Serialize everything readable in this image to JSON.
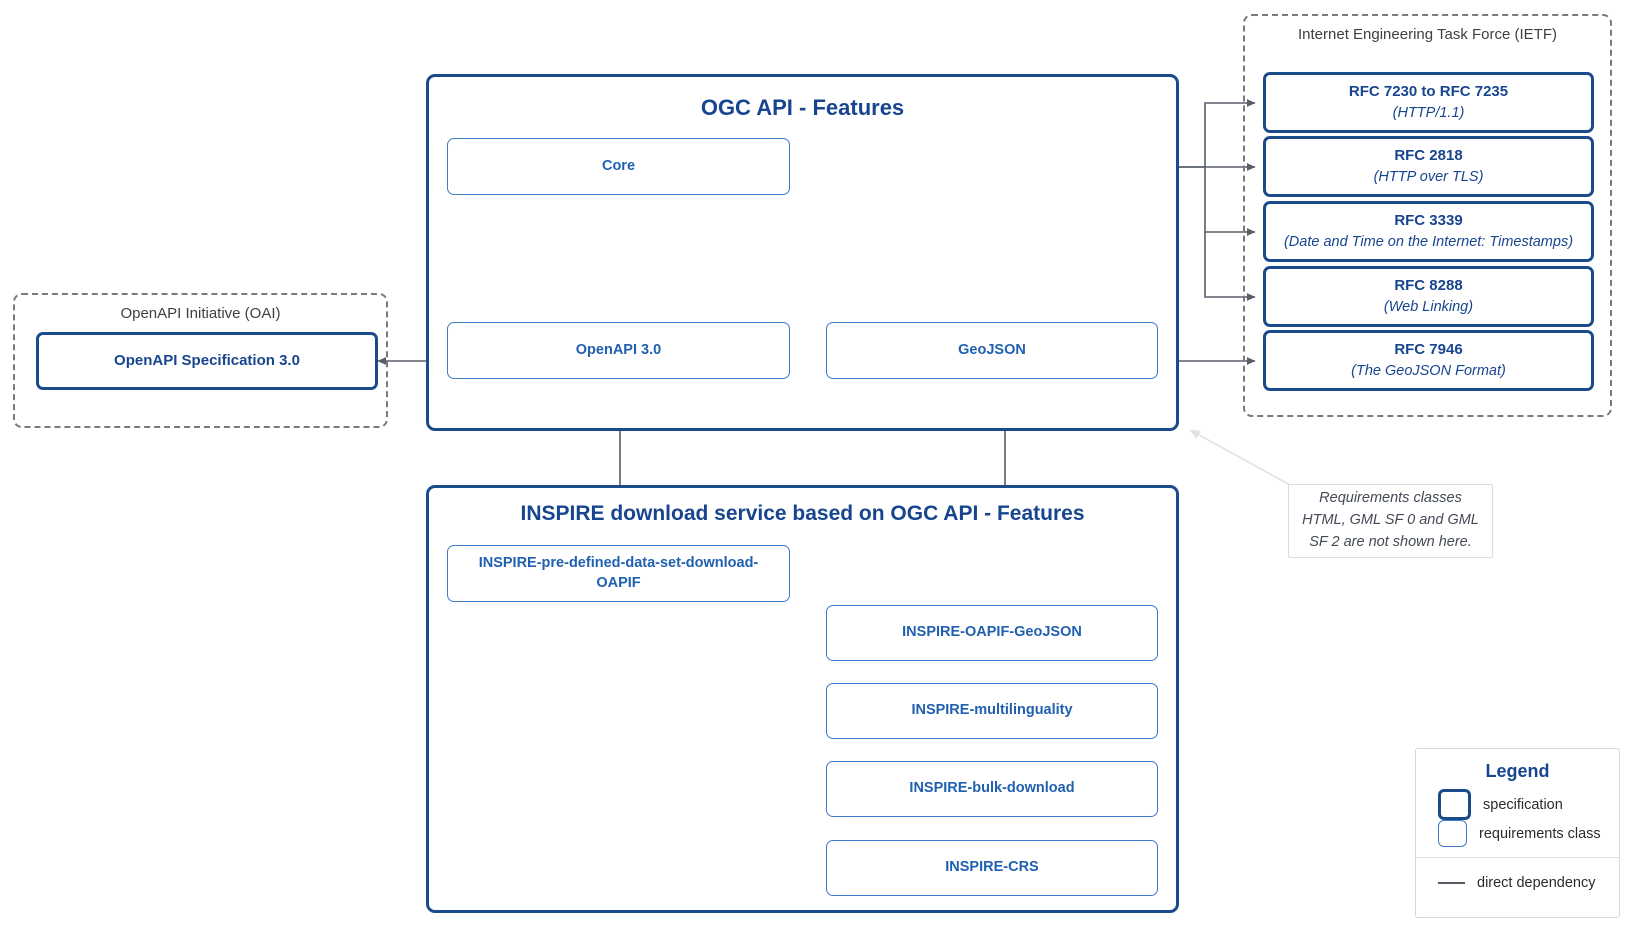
{
  "diagram": {
    "ogc": {
      "title": "OGC API - Features",
      "boxes": {
        "core": "Core",
        "openapi": "OpenAPI 3.0",
        "geojson": "GeoJSON"
      }
    },
    "inspire": {
      "title": "INSPIRE download service based on OGC API - Features",
      "boxes": {
        "predefined": "INSPIRE-pre-defined-data-set-download-OAPIF",
        "oapif_geojson": "INSPIRE-OAPIF-GeoJSON",
        "multilinguality": "INSPIRE-multilinguality",
        "bulk_download": "INSPIRE-bulk-download",
        "crs": "INSPIRE-CRS"
      }
    },
    "oai": {
      "title": "OpenAPI Initiative (OAI)",
      "spec": {
        "name": "OpenAPI Specification 3.0",
        "detail": ""
      }
    },
    "ietf": {
      "title": "Internet Engineering Task Force (IETF)",
      "specs": [
        {
          "name": "RFC 7230 to RFC 7235",
          "detail": "(HTTP/1.1)"
        },
        {
          "name": "RFC 2818",
          "detail": "(HTTP over TLS)"
        },
        {
          "name": "RFC 3339",
          "detail": "(Date and Time on the Internet: Timestamps)"
        },
        {
          "name": "RFC 8288",
          "detail": "(Web Linking)"
        },
        {
          "name": "RFC 7946",
          "detail": "(The GeoJSON Format)"
        }
      ]
    },
    "note": {
      "line1": "Requirements classes",
      "line2": "HTML, GML SF 0 and GML",
      "line3": "SF 2 are not shown here."
    },
    "legend": {
      "title": "Legend",
      "specification": "specification",
      "requirements_class": "requirements class",
      "direct_dependency": "direct dependency"
    },
    "colors": {
      "specification_border": "#1a4c8b",
      "requirements_class_border": "#3d7cc9",
      "title_text": "#17458f",
      "label_text": "#2060b0",
      "connector": "#555c66",
      "organisation_border": "#7a7a7a"
    }
  }
}
